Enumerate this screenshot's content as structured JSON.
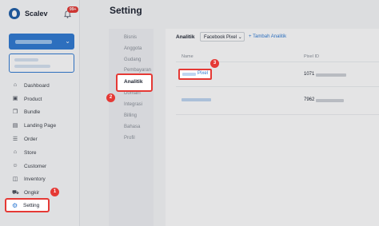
{
  "brand": {
    "name": "Scalev",
    "notification_count": "99+"
  },
  "sidebar": {
    "items": [
      {
        "label": "Dashboard",
        "icon": "home-icon"
      },
      {
        "label": "Product",
        "icon": "box-icon"
      },
      {
        "label": "Bundle",
        "icon": "bundle-icon"
      },
      {
        "label": "Landing Page",
        "icon": "page-icon"
      },
      {
        "label": "Order",
        "icon": "order-icon"
      },
      {
        "label": "Store",
        "icon": "store-icon"
      },
      {
        "label": "Customer",
        "icon": "users-icon"
      },
      {
        "label": "Inventory",
        "icon": "inventory-icon"
      },
      {
        "label": "Ongkir",
        "icon": "truck-icon"
      }
    ],
    "active": {
      "label": "Setting",
      "icon": "gear-icon"
    }
  },
  "header": {
    "title": "Setting"
  },
  "submenu": {
    "items": [
      "Bisnis",
      "Anggota",
      "Gudang",
      "Pembayaran",
      "Analitik",
      "Domain",
      "Integrasi",
      "Billing",
      "Bahasa",
      "Profil"
    ],
    "active": "Analitik"
  },
  "content": {
    "title": "Analitik",
    "dropdown_value": "Facebook Pixel",
    "add_label": "+ Tambah Analitik",
    "columns": {
      "name": "Name",
      "pixel_id": "Pixel ID"
    },
    "rows": [
      {
        "name_suffix": "Pixel",
        "pixel_id_prefix": "1071"
      },
      {
        "name_suffix": "",
        "pixel_id_prefix": "7962"
      }
    ]
  },
  "step_badges": [
    "1",
    "2",
    "3"
  ],
  "colors": {
    "accent": "#2f7ad3",
    "highlight": "#e53935"
  }
}
